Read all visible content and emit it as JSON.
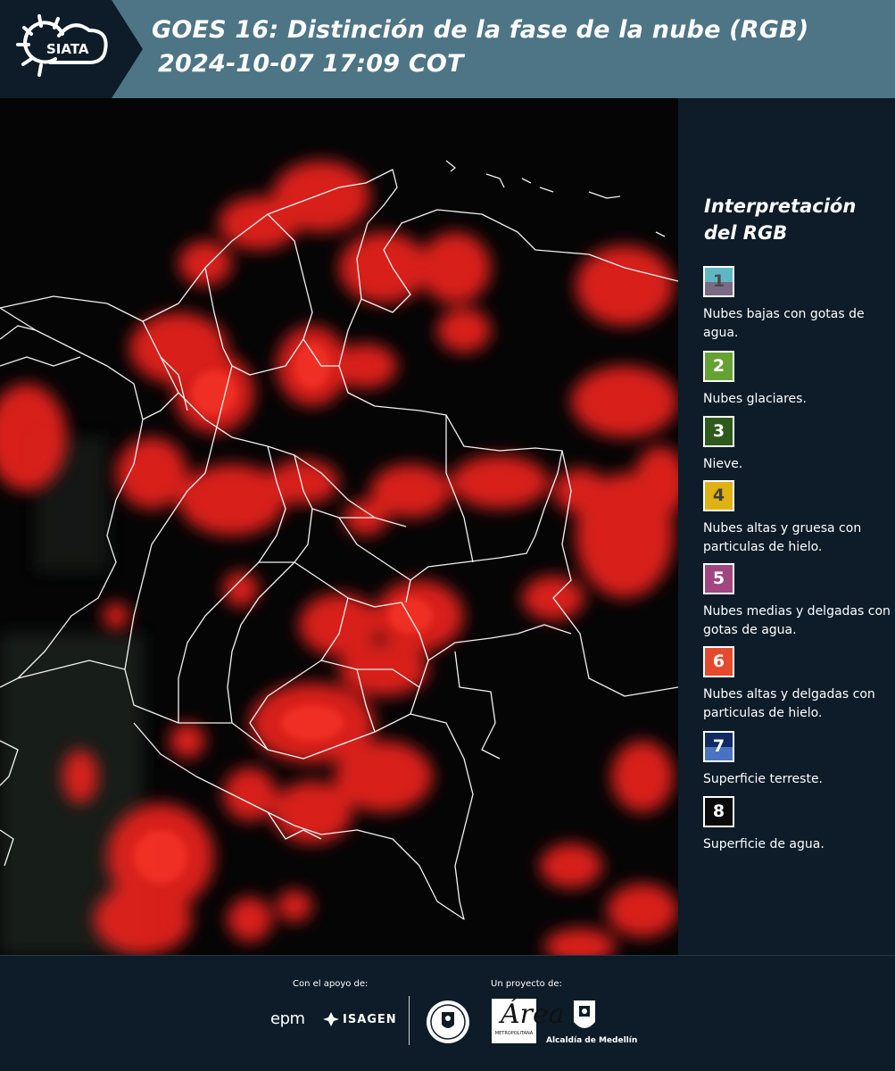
{
  "header": {
    "logo_text": "SIATA",
    "title_line_1": "GOES 16: Distinción de la fase de la nube (RGB)",
    "title_line_2": "2024-10-07 17:09 COT",
    "background": "#4d7585"
  },
  "map": {
    "description_icon": "colombia-satellite-map",
    "cloud_color": "#e8231c",
    "background": "#050506",
    "border_color": "#ffffff"
  },
  "legend": {
    "title_line_1": "Interpretación",
    "title_line_2": "del RGB",
    "items": [
      {
        "number": "1",
        "top_color": "#5fb7c4",
        "bottom_color": "#7a6a86",
        "number_color": "#4a4a4a",
        "label": "Nubes bajas con gotas de agua."
      },
      {
        "number": "2",
        "top_color": "#66a233",
        "bottom_color": "#66a233",
        "number_color": "#ffffff",
        "label": "Nubes glaciares."
      },
      {
        "number": "3",
        "top_color": "#2e5a1c",
        "bottom_color": "#2e5a1c",
        "number_color": "#ffffff",
        "label": "Nieve."
      },
      {
        "number": "4",
        "top_color": "#e0b113",
        "bottom_color": "#e0b113",
        "number_color": "#3f3f3f",
        "label": "Nubes altas y gruesa con particulas de hielo."
      },
      {
        "number": "5",
        "top_color": "#a04680",
        "bottom_color": "#a04680",
        "number_color": "#ffffff",
        "label": "Nubes medias y delgadas con gotas de agua."
      },
      {
        "number": "6",
        "top_color": "#e6492c",
        "bottom_color": "#e6492c",
        "number_color": "#ffffff",
        "label": "Nubes altas y delgadas con particulas de hielo."
      },
      {
        "number": "7",
        "top_color": "#0f2a64",
        "bottom_color": "#4a73c2",
        "number_color": "#ffffff",
        "label": "Superficie terreste."
      },
      {
        "number": "8",
        "top_color": "#0a0a0a",
        "bottom_color": "#0a0a0a",
        "number_color": "#ffffff",
        "label": "Superficie de agua."
      }
    ]
  },
  "footer": {
    "support_label": "Con el apoyo de:",
    "project_label": "Un proyecto de:",
    "epm": "epm",
    "isagen": "ISAGEN",
    "area_glyph": "Área",
    "area_text": "METROPOLITANA",
    "alcaldia": "Alcaldía de Medellín"
  }
}
